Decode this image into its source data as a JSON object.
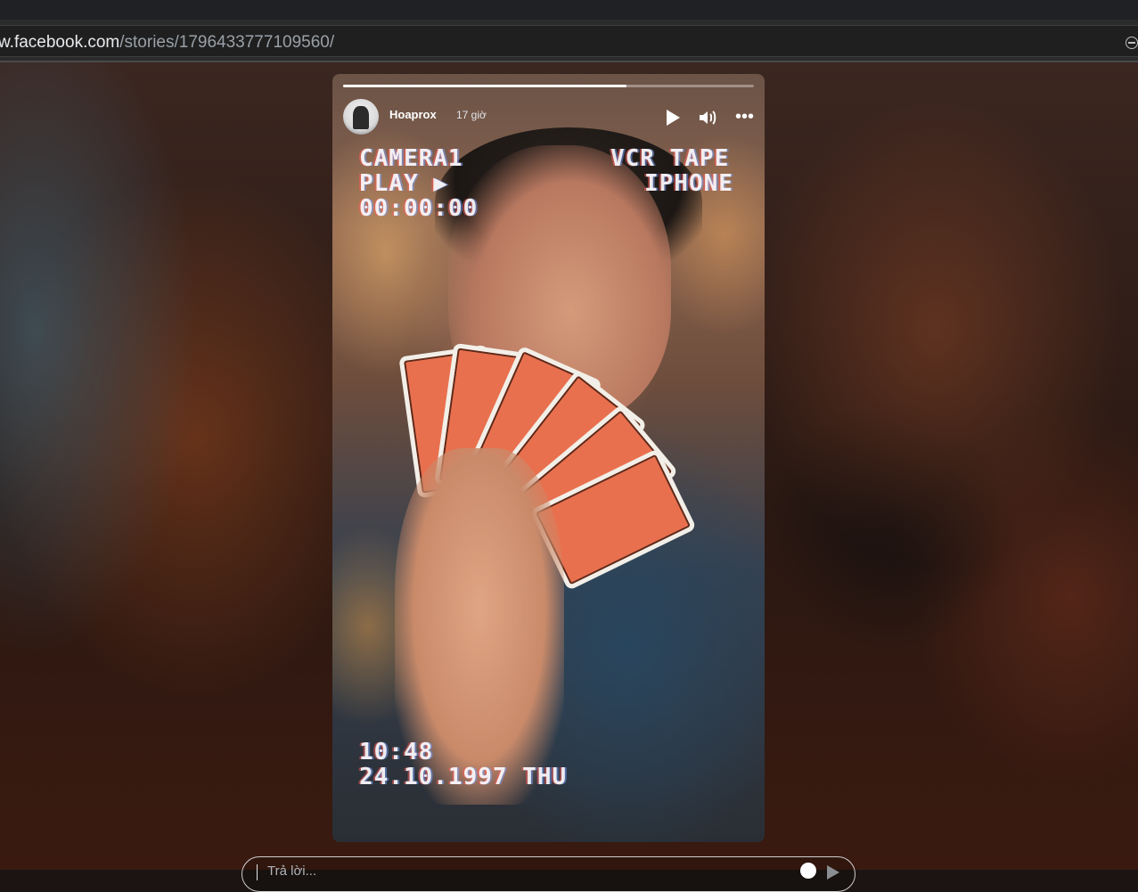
{
  "browser": {
    "url_host": "w.facebook.com",
    "url_path": "/stories/1796433777109560/"
  },
  "story": {
    "progress": 0.69,
    "username": "Hoaprox",
    "timestamp": "17 giờ",
    "overlay": {
      "line1_left": "CAMERA1",
      "line2_left": "PLAY ▶",
      "counter": "00:00:00",
      "line1_right": "VCR TAPE",
      "line2_right": "IPHONE",
      "time": "10:48",
      "date": "24.10.1997 THU"
    },
    "icons": [
      "play-icon",
      "volume-icon",
      "more-icon"
    ]
  },
  "reply": {
    "placeholder": "Trả lời..."
  }
}
